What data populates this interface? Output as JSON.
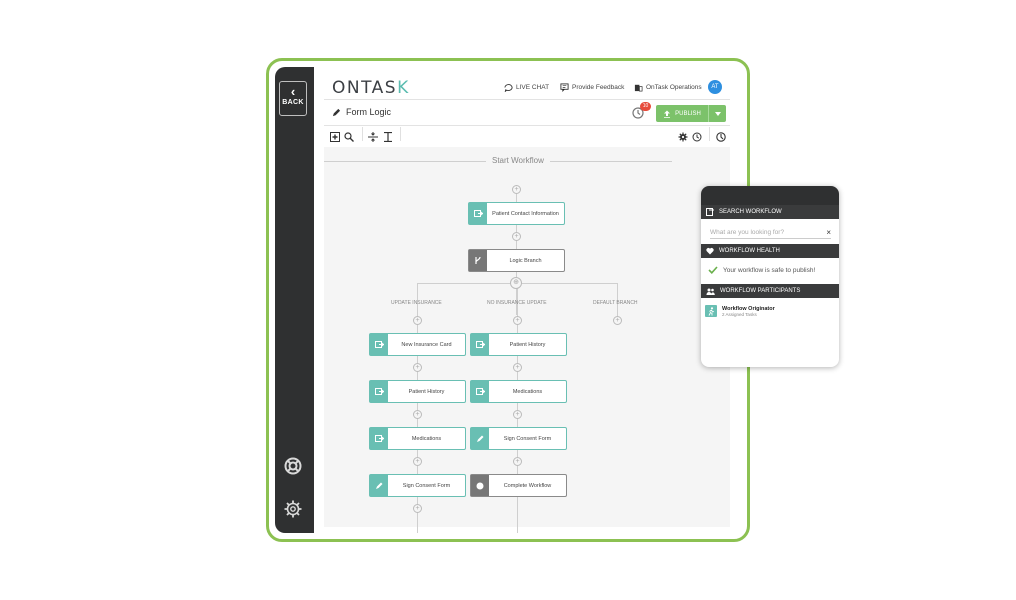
{
  "sidebar": {
    "back_label": "BACK"
  },
  "header": {
    "logo_main": "ONTAS",
    "logo_accent": "K",
    "live_chat": "LIVE CHAT",
    "feedback": "Provide Feedback",
    "operations": "OnTask Operations",
    "avatar": "AT"
  },
  "titlebar": {
    "form_title": "Form Logic",
    "history_badge": "10",
    "publish_label": "PUBLISH"
  },
  "canvas": {
    "start_label": "Start Workflow",
    "nodes": {
      "patient_contact": "Patient Contact Information",
      "logic_branch": "Logic Branch",
      "ins_card": "New Insurance Card",
      "hist_left": "Patient History",
      "meds_left": "Medications",
      "consent_left": "Sign Consent Form",
      "hist_mid": "Patient History",
      "meds_mid": "Medications",
      "consent_mid": "Sign Consent Form",
      "complete": "Complete Workflow"
    },
    "branches": {
      "update": "UPDATE INSURANCE",
      "no_update": "NO INSURANCE UPDATE",
      "default": "DEFAULT BRANCH"
    }
  },
  "panel": {
    "search_title": "SEARCH WORKFLOW",
    "search_placeholder": "What are you looking for?",
    "health_title": "WORKFLOW HEALTH",
    "health_status": "Your workflow is safe to publish!",
    "participants_title": "WORKFLOW PARTICIPANTS",
    "participant_name": "Workflow Originator",
    "participant_tasks": "2 Assigned Tasks"
  },
  "colors": {
    "accent_green": "#8cc152",
    "teal": "#69bfb3",
    "dark": "#2f3031",
    "publish": "#7cc26a",
    "badge": "#e74c3c"
  }
}
